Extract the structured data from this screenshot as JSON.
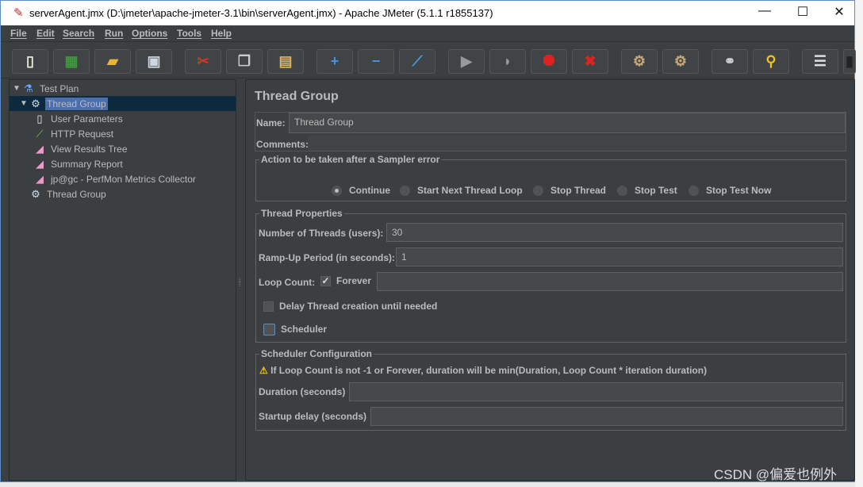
{
  "window": {
    "title": "serverAgent.jmx (D:\\jmeter\\apache-jmeter-3.1\\bin\\serverAgent.jmx) - Apache JMeter (5.1.1 r1855137)",
    "minimize": "—",
    "maximize": "☐",
    "close": "✕"
  },
  "menu": [
    "File",
    "Edit",
    "Search",
    "Run",
    "Options",
    "Tools",
    "Help"
  ],
  "toolbar": [
    {
      "icon": "new-icon",
      "glyph": "▯",
      "color": "#f0f0e0"
    },
    {
      "icon": "templates-icon",
      "glyph": "▦",
      "color": "#3c9a3c"
    },
    {
      "icon": "open-icon",
      "glyph": "▰",
      "color": "#e8b33a"
    },
    {
      "icon": "save-icon",
      "glyph": "▣",
      "color": "#cfd8e0"
    },
    {
      "icon": "cut-icon",
      "glyph": "✂",
      "color": "#d32"
    },
    {
      "icon": "copy-icon",
      "glyph": "❐",
      "color": "#ccc"
    },
    {
      "icon": "paste-icon",
      "glyph": "▤",
      "color": "#d9b36a"
    },
    {
      "icon": "expand-icon",
      "glyph": "+",
      "color": "#4a90e2"
    },
    {
      "icon": "collapse-icon",
      "glyph": "−",
      "color": "#4a90e2"
    },
    {
      "icon": "toggle-icon",
      "glyph": "⟋",
      "color": "#4a9ae2"
    },
    {
      "icon": "start-icon",
      "glyph": "▶",
      "color": "#999"
    },
    {
      "icon": "start-no-pauses-icon",
      "glyph": "◗",
      "color": "#999"
    },
    {
      "icon": "stop-icon",
      "glyph": "⯃",
      "color": "#d22"
    },
    {
      "icon": "shutdown-icon",
      "glyph": "✖",
      "color": "#d22"
    },
    {
      "icon": "clear-icon",
      "glyph": "⚙",
      "color": "#c9a878"
    },
    {
      "icon": "clear-all-icon",
      "glyph": "⚙",
      "color": "#c9a878"
    },
    {
      "icon": "search-icon",
      "glyph": "⚭",
      "color": "#ccc"
    },
    {
      "icon": "reset-search-icon",
      "glyph": "⚲",
      "color": "#f0c020"
    },
    {
      "icon": "function-helper-icon",
      "glyph": "☰",
      "color": "#ddd"
    },
    {
      "icon": "help-icon",
      "glyph": "▮",
      "color": "#222"
    }
  ],
  "tree": [
    {
      "label": "Test Plan",
      "icon": "flask-icon",
      "glyph": "⚗",
      "color": "#6af",
      "level": 0,
      "expanded": true
    },
    {
      "label": "Thread Group",
      "icon": "gear-icon",
      "glyph": "⚙",
      "color": "#cde",
      "level": 1,
      "expanded": true,
      "selected": true
    },
    {
      "label": "User Parameters",
      "icon": "preprocessor-icon",
      "glyph": "▯",
      "color": "#eee",
      "level": 2
    },
    {
      "label": "HTTP Request",
      "icon": "pipette-icon",
      "glyph": "⟋",
      "color": "#7c4",
      "level": 2
    },
    {
      "label": "View Results Tree",
      "icon": "listener-icon",
      "glyph": "◢",
      "color": "#e9c",
      "level": 2
    },
    {
      "label": "Summary Report",
      "icon": "listener-icon",
      "glyph": "◢",
      "color": "#e9c",
      "level": 2
    },
    {
      "label": "jp@gc - PerfMon Metrics Collector",
      "icon": "listener-icon",
      "glyph": "◢",
      "color": "#e9c",
      "level": 2
    },
    {
      "label": "Thread Group",
      "icon": "gear-icon",
      "glyph": "⚙",
      "color": "#cde",
      "level": 1
    }
  ],
  "panel": {
    "title": "Thread Group",
    "name_label": "Name:",
    "name_value": "Thread Group",
    "comments_label": "Comments:",
    "comments_value": "",
    "error_action": {
      "legend": "Action to be taken after a Sampler error",
      "options": [
        "Continue",
        "Start Next Thread Loop",
        "Stop Thread",
        "Stop Test",
        "Stop Test Now"
      ],
      "selected": "Continue"
    },
    "thread_props": {
      "legend": "Thread Properties",
      "threads_label": "Number of Threads (users):",
      "threads_value": "30",
      "rampup_label": "Ramp-Up Period (in seconds):",
      "rampup_value": "1",
      "loop_label": "Loop Count:",
      "forever_label": "Forever",
      "forever_checked": true,
      "loop_value": "",
      "delay_label": "Delay Thread creation until needed",
      "delay_checked": false,
      "scheduler_label": "Scheduler",
      "scheduler_checked": false
    },
    "scheduler": {
      "legend": "Scheduler Configuration",
      "warning": "If Loop Count is not -1 or Forever, duration will be min(Duration, Loop Count * iteration duration)",
      "duration_label": "Duration (seconds)",
      "duration_value": "",
      "startup_label": "Startup delay (seconds)",
      "startup_value": ""
    }
  },
  "watermark": "CSDN @偏爱也例外"
}
